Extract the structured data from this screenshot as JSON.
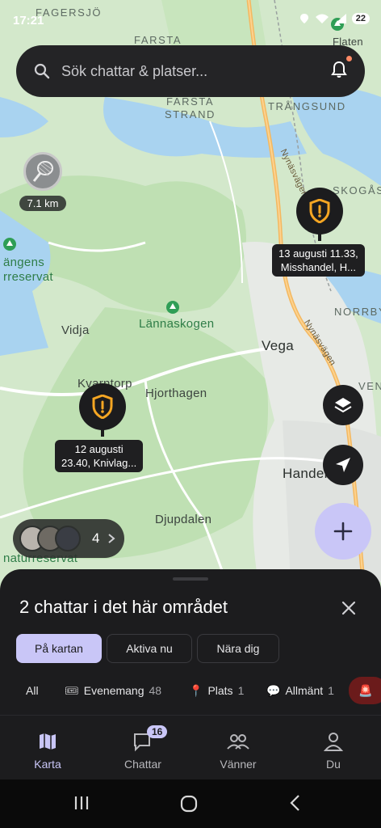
{
  "status": {
    "time": "17:21",
    "battery": "22"
  },
  "search": {
    "placeholder": "Sök chattar & platser..."
  },
  "map": {
    "labels": {
      "fagersjo": "FAGERSJÖ",
      "farsta": "FARSTA",
      "farsta_strand": "FARSTA STRAND",
      "trangsund": "TRÅNGSUND",
      "skogas": "SKOGÅS",
      "flaten": "Flaten",
      "nynasvagen1": "Nynäsvägen",
      "nynasvagen2": "Nynäsvägen",
      "norrby": "NORRBY",
      "vidja": "Vidja",
      "lannaskogen": "Lännaskogen",
      "vega": "Vega",
      "kvarntorp": "Kvarntorp",
      "hjorthagen": "Hjorthagen",
      "djupdalen": "Djupdalen",
      "handen": "Handen",
      "langens": "ängens",
      "rreservat": "rreservat",
      "naturreservat": "naturreservat",
      "veni": "VENI"
    },
    "distance_marker": {
      "label": "7.1 km"
    },
    "incidents": [
      {
        "line1": "13 augusti 11.33,",
        "line2": "Misshandel, H..."
      },
      {
        "line1": "12 augusti",
        "line2": "23.40, Knivlag..."
      }
    ],
    "friends": {
      "count": "4"
    }
  },
  "sheet": {
    "title": "2 chattar i det här området",
    "segments": [
      {
        "label": "På kartan",
        "active": true
      },
      {
        "label": "Aktiva nu",
        "active": false
      },
      {
        "label": "Nära dig",
        "active": false
      }
    ],
    "chips": [
      {
        "label": "All"
      },
      {
        "icon": "ticket-icon",
        "label": "Evenemang",
        "count": "48"
      },
      {
        "icon": "pin-icon",
        "label": "Plats",
        "count": "1"
      },
      {
        "icon": "speech-bubble-icon",
        "label": "Allmänt",
        "count": "1"
      }
    ]
  },
  "tabs": [
    {
      "label": "Karta",
      "active": true
    },
    {
      "label": "Chattar",
      "badge": "16"
    },
    {
      "label": "Vänner"
    },
    {
      "label": "Du"
    }
  ],
  "colors": {
    "accent": "#c9c6f7",
    "incident": "#f5a623",
    "water": "#a9d3f0",
    "land": "#d6ead0"
  }
}
